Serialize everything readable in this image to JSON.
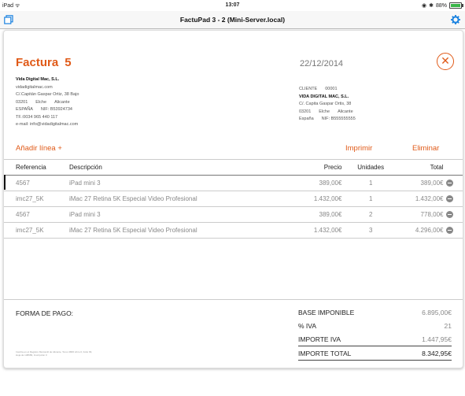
{
  "status": {
    "device": "iPad",
    "time": "13:07",
    "battery": "88%"
  },
  "nav": {
    "title": "FactuPad 3 - 2 (Mini-Server.local)"
  },
  "invoice": {
    "label": "Factura",
    "number": "5",
    "date": "22/12/2014"
  },
  "company": {
    "name": "Vida Digital Mac, S.L.",
    "web": "vidadigitalmac.com",
    "street": "C/.Capitán Gaspar Ortiz, 38 Bajo",
    "zip": "03201",
    "city": "Elche",
    "province": "Alicante",
    "country": "ESPAÑA",
    "nif": "NIF: B53924734",
    "phone": "TF.:0034 965 440 117",
    "email": "e-mail: info@vidadigitalmac.com"
  },
  "client": {
    "label": "CLIENTE",
    "id": "00001",
    "name": "VIDA DIGITAL MAC, S.L.",
    "street": "C/. Capita Gaspar Ortis, 38",
    "zip": "03201",
    "city": "Elche",
    "province": "Alicante",
    "country": "España",
    "nif": "NIF: B555555555"
  },
  "actions": {
    "add": "Añadir línea +",
    "print": "Imprimir",
    "delete": "Eliminar"
  },
  "table": {
    "headers": {
      "ref": "Referencia",
      "desc": "Descripción",
      "price": "Precio",
      "units": "Unidades",
      "total": "Total"
    },
    "rows": [
      {
        "ref": "4567",
        "desc": "iPad mini 3",
        "price": "389,00€",
        "units": "1",
        "total": "389,00€"
      },
      {
        "ref": "imc27_5K",
        "desc": "iMac 27 Retina 5K Especial Video Profesional",
        "price": "1.432,00€",
        "units": "1",
        "total": "1.432,00€"
      },
      {
        "ref": "4567",
        "desc": "iPad mini 3",
        "price": "389,00€",
        "units": "2",
        "total": "778,00€"
      },
      {
        "ref": "imc27_5K",
        "desc": "iMac 27 Retina 5K Especial Video Profesional",
        "price": "1.432,00€",
        "units": "3",
        "total": "4.296,00€"
      }
    ]
  },
  "footer": {
    "payment_label": "FORMA DE PAGO:",
    "legal": "Inscrita en el Registro Mercantil de Alicante, Tomo 3806 Libro 0, Folio 66, Hoja de 138689, Inscripción 0",
    "base_label": "BASE IMPONIBLE",
    "base_value": "6.895,00€",
    "iva_label": "% IVA",
    "iva_value": "21",
    "importe_iva_label": "IMPORTE IVA",
    "importe_iva_value": "1.447,95€",
    "total_label": "IMPORTE TOTAL",
    "total_value": "8.342,95€"
  },
  "colors": {
    "accent": "#e05a18",
    "nav_icon": "#1a82e0"
  }
}
